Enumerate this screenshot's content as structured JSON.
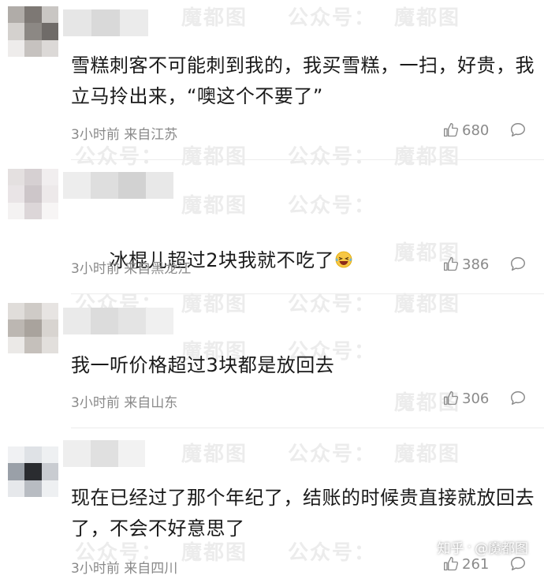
{
  "watermark": {
    "label1": "公众号：",
    "label2": "魔都图",
    "label3": "公众号：魔都图"
  },
  "comments": [
    {
      "text": "雪糕刺客不可能刺到我的，我买雪糕，一扫，好贵，我立马拎出来，“噢这个不要了”",
      "time": "3小时前",
      "location": "来自江苏",
      "likes": "680",
      "avatar_colors": [
        "#b0aca8",
        "#7d7874",
        "#c9c6c3",
        "#d4d1ce",
        "#8c8884",
        "#6f6b68",
        "#eeeceb",
        "#c6c2bf",
        "#dcd9d7"
      ]
    },
    {
      "text": "冰棍儿超过2块我就不吃了",
      "emoji": "laughing-crying-emoji",
      "time": "3小时前",
      "location": "来自黑龙江",
      "likes": "386",
      "avatar_colors": [
        "#e4e0e0",
        "#d6d0d2",
        "#f1eeef",
        "#e9e4e6",
        "#cdc6c9",
        "#ede9ea",
        "#f4f2f2",
        "#dcd6d8",
        "#f7f5f5"
      ]
    },
    {
      "text": "我一听价格超过3块都是放回去",
      "time": "3小时前",
      "location": "来自山东",
      "likes": "306",
      "avatar_colors": [
        "#e0ddda",
        "#cfcbc7",
        "#e7e4e2",
        "#bcb7b2",
        "#a9a39d",
        "#d8d4d0",
        "#ebe9e7",
        "#c5c0bb",
        "#e2dfdc"
      ]
    },
    {
      "text": "现在已经过了那个年纪了，结账的时候贵直接就放回去了，不会不好意思了",
      "time": "3小时前",
      "location": "来自四川",
      "likes": "261",
      "avatar_colors": [
        "#f0f1f3",
        "#dfe2e6",
        "#eef0f2",
        "#9aa0a8",
        "#2a2c30",
        "#c9ccd1",
        "#e6e8eb",
        "#b8bcc2",
        "#eef0f2"
      ]
    }
  ],
  "zhihu": {
    "platform": "知乎",
    "account": "@魔都图"
  },
  "colors": {
    "text": "#1a1a1a",
    "meta": "#8a8a8a",
    "divider": "#ececec"
  }
}
